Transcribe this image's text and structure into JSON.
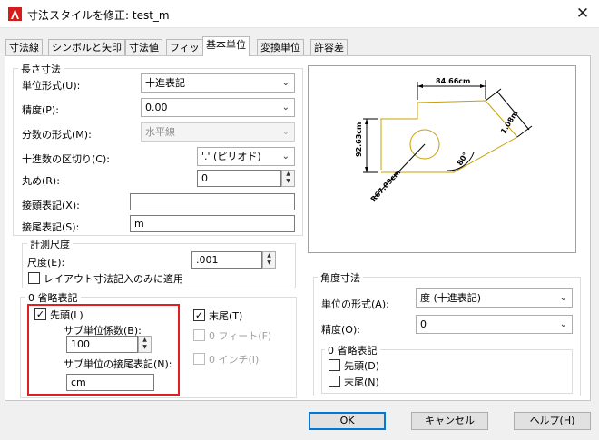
{
  "window": {
    "title": "寸法スタイルを修正: test_m",
    "close_glyph": "✕"
  },
  "tabs": [
    "寸法線",
    "シンボルと矢印",
    "寸法値",
    "フィット",
    "基本単位",
    "変換単位",
    "許容差"
  ],
  "linear": {
    "group_title": "長さ寸法",
    "unit_format_label": "単位形式(U):",
    "unit_format_value": "十進表記",
    "precision_label": "精度(P):",
    "precision_value": "0.00",
    "fraction_label": "分数の形式(M):",
    "fraction_value": "水平線",
    "decimal_sep_label": "十進数の区切り(C):",
    "decimal_sep_value": "'.' (ピリオド)",
    "roundoff_label": "丸め(R):",
    "roundoff_value": "0",
    "prefix_label": "接頭表記(X):",
    "prefix_value": "",
    "suffix_label": "接尾表記(S):",
    "suffix_value": "m"
  },
  "measurement_scale": {
    "group_title": "計測尺度",
    "scale_label": "尺度(E):",
    "scale_value": ".001",
    "layout_only_label": "レイアウト寸法記入のみに適用",
    "layout_only_checked": false
  },
  "zero_suppression": {
    "group_title": "0 省略表記",
    "leading_label": "先頭(L)",
    "leading_checked": true,
    "sub_factor_label": "サブ単位係数(B):",
    "sub_factor_value": "100",
    "sub_suffix_label": "サブ単位の接尾表記(N):",
    "sub_suffix_value": "cm",
    "trailing_label": "末尾(T)",
    "trailing_checked": true,
    "feet_label": "0 フィート(F)",
    "feet_checked": false,
    "inches_label": "0 インチ(I)",
    "inches_checked": false
  },
  "angular": {
    "group_title": "角度寸法",
    "units_label": "単位の形式(A):",
    "units_value": "度 (十進表記)",
    "precision_label": "精度(O):",
    "precision_value": "0",
    "zero_title": "0 省略表記",
    "leading_label": "先頭(D)",
    "leading_checked": false,
    "trailing_label": "末尾(N)",
    "trailing_checked": false
  },
  "preview": {
    "dim_top": "84.66cm",
    "dim_left": "92.63cm",
    "dim_right": "1.08m",
    "dim_angle": "80°",
    "dim_radius": "R67.09cm",
    "line_color": "#c8a000"
  },
  "buttons": {
    "ok": "OK",
    "cancel": "キャンセル",
    "help": "ヘルプ(H)"
  },
  "colors": {
    "accent": "#0078d7",
    "highlight": "#e02020",
    "autocad_red": "#d91a1a"
  }
}
